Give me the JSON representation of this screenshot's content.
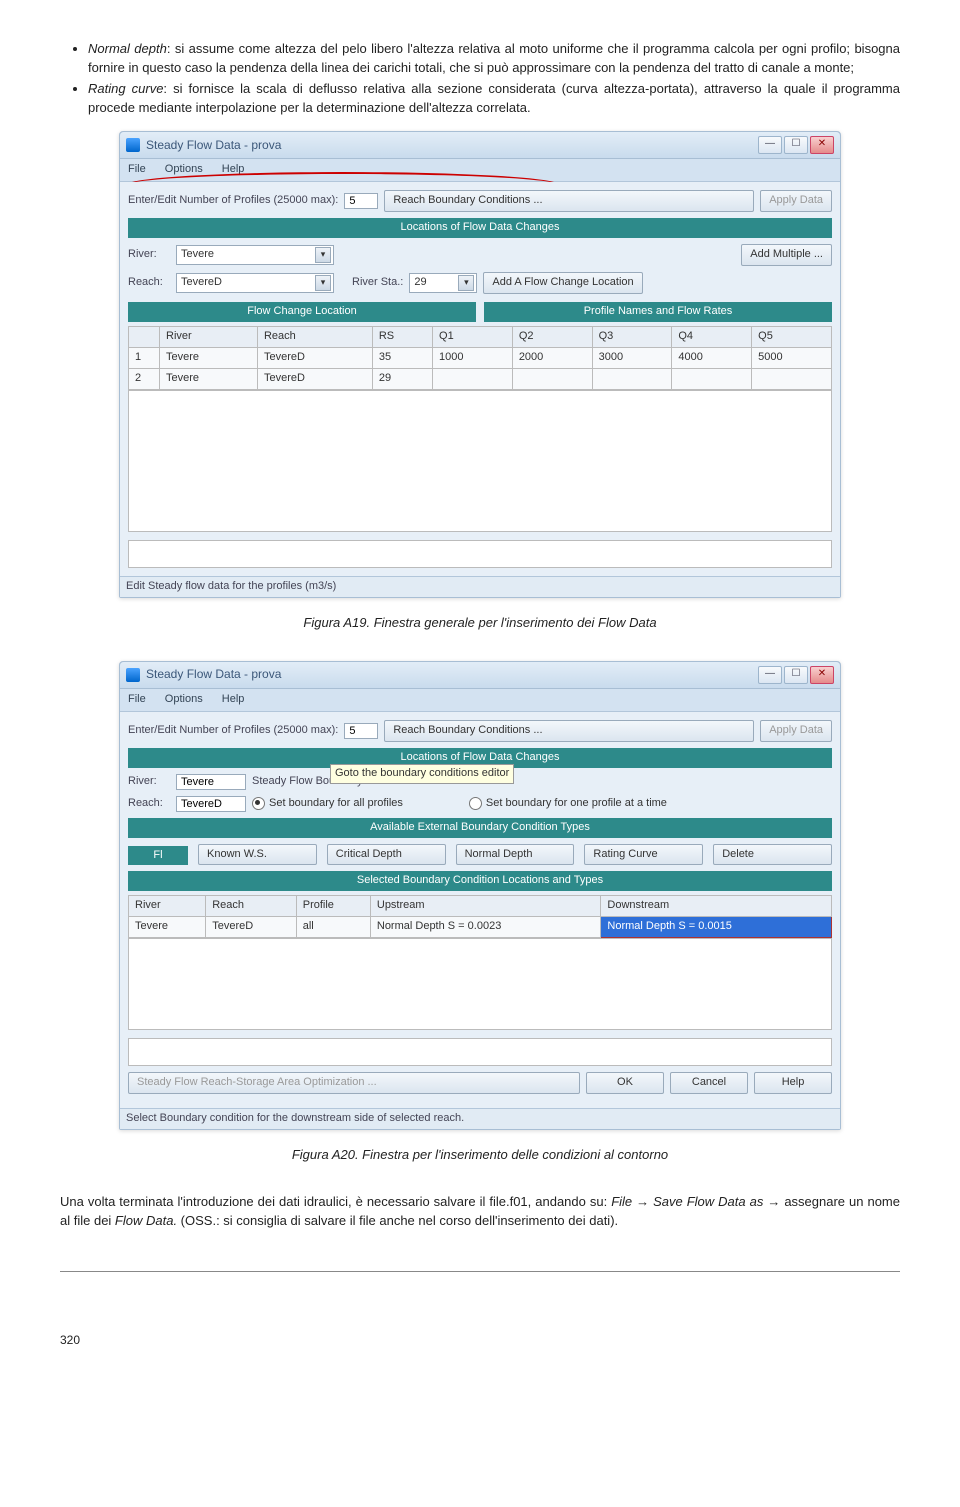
{
  "bullets": [
    {
      "lead": "Normal depth",
      "text": ": si assume come altezza del pelo libero l'altezza relativa al moto uniforme che il programma calcola per ogni profilo; bisogna fornire in questo caso la pendenza della linea dei carichi totali, che si può approssimare con la pendenza del tratto di canale a monte;"
    },
    {
      "lead": "Rating curve",
      "text": ": si fornisce la scala di deflusso relativa alla sezione considerata (curva altezza-portata), attraverso la quale il programma procede mediante interpolazione per la determinazione dell'altezza correlata."
    }
  ],
  "fig19": {
    "title": "Steady Flow Data - prova",
    "menu": [
      "File",
      "Options",
      "Help"
    ],
    "profiles_label": "Enter/Edit Number of Profiles (25000 max):",
    "profiles_value": "5",
    "reach_bc_btn": "Reach Boundary Conditions ...",
    "apply_btn": "Apply Data",
    "loc_banner": "Locations of Flow Data Changes",
    "river_lbl": "River:",
    "river_val": "Tevere",
    "reach_lbl": "Reach:",
    "reach_val": "TevereD",
    "riversta_lbl": "River Sta.:",
    "riversta_val": "29",
    "add_multiple_btn": "Add Multiple ...",
    "add_flow_btn": "Add A Flow Change Location",
    "half_left": "Flow Change Location",
    "half_right": "Profile Names and Flow Rates",
    "cols": [
      "",
      "River",
      "Reach",
      "RS",
      "Q1",
      "Q2",
      "Q3",
      "Q4",
      "Q5"
    ],
    "rows": [
      [
        "1",
        "Tevere",
        "TevereD",
        "35",
        "1000",
        "2000",
        "3000",
        "4000",
        "5000"
      ],
      [
        "2",
        "Tevere",
        "TevereD",
        "29",
        "",
        "",
        "",
        "",
        ""
      ]
    ],
    "status": "Edit Steady flow data for the profiles (m3/s)",
    "caption": "Figura A19. Finestra generale per l'inserimento dei Flow Data"
  },
  "fig20": {
    "title": "Steady Flow Data - prova",
    "menu": [
      "File",
      "Options",
      "Help"
    ],
    "profiles_label": "Enter/Edit Number of Profiles (25000 max):",
    "profiles_value": "5",
    "reach_bc_btn": "Reach Boundary Conditions ...",
    "apply_btn": "Apply Data",
    "loc_banner": "Locations of Flow Data Changes",
    "tooltip": "Goto the boundary conditions editor",
    "river_lbl": "River:",
    "river_val": "Tevere",
    "reach_lbl": "Reach:",
    "reach_val": "TevereD",
    "bc_title": "Steady Flow Boundary",
    "radio1": "Set boundary for all profiles",
    "radio2": "Set boundary for one profile at a time",
    "banner_avail": "Available External Boundary Condition Types",
    "btns": [
      "Known W.S.",
      "Critical Depth",
      "Normal Depth",
      "Rating Curve",
      "Delete"
    ],
    "banner_sel": "Selected Boundary Condition Locations and Types",
    "cols": [
      "River",
      "Reach",
      "Profile",
      "Upstream",
      "Downstream"
    ],
    "row": [
      "Tevere",
      "TevereD",
      "all",
      "Normal Depth S = 0.0023",
      "Normal Depth S = 0.0015"
    ],
    "storage_btn": "Steady Flow Reach-Storage Area Optimization ...",
    "ok": "OK",
    "cancel": "Cancel",
    "help": "Help",
    "status": "Select Boundary condition for the downstream side of selected reach.",
    "caption": "Figura A20. Finestra per l'inserimento delle condizioni al contorno"
  },
  "after": {
    "p1a": "Una volta terminata l'introduzione dei dati idraulici, è necessario salvare il file",
    "p1b": ".f01, andando su: ",
    "p1c": "File → Save Flow Data as",
    "p1d": " → assegnare un nome al file dei ",
    "p1e": "Flow Data.",
    "p1f": " (OSS.: si consiglia di salvare il file anche nel corso dell'inserimento dei dati)."
  },
  "pagenum": "320"
}
